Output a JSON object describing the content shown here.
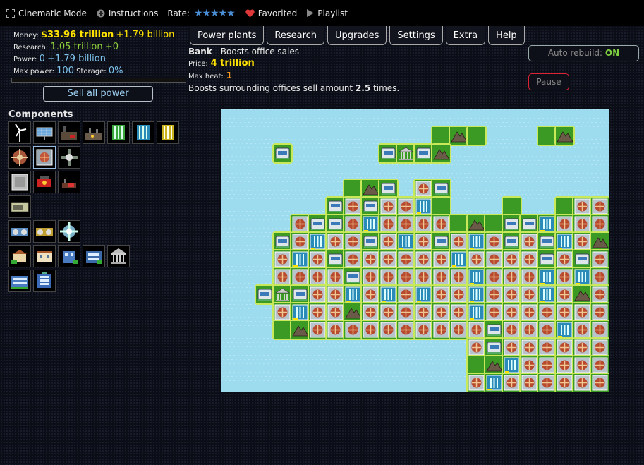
{
  "topbar": {
    "cinematic_label": "Cinematic Mode",
    "instructions_label": "Instructions",
    "rate_label": "Rate:",
    "stars": "★★★★★",
    "favorited_label": "Favorited",
    "playlist_label": "Playlist"
  },
  "stats": {
    "money_label": "Money:",
    "money_value": "$33.96 trillion",
    "money_rate": "+1.79 billion",
    "research_label": "Research:",
    "research_value": "1.05 trillion",
    "research_rate": "+0",
    "power_label": "Power:",
    "power_value": "0",
    "power_rate": "+1.79 billion",
    "maxpower_label": "Max power:",
    "maxpower_value": "100",
    "storage_label": "Storage:",
    "storage_value": "0%",
    "storage_fill": 0
  },
  "sell_button": "Sell all power",
  "tabs": [
    "Power plants",
    "Research",
    "Upgrades",
    "Settings",
    "Extra",
    "Help"
  ],
  "info": {
    "name": "Bank",
    "desc": " - Boosts office sales",
    "price_label": "Price:",
    "price_value": "4 trillion",
    "heat_label": "Max heat:",
    "heat_value": "1",
    "effect_pre": "Boosts surrounding offices sell amount ",
    "effect_value": "2.5",
    "effect_post": " times."
  },
  "auto_rebuild": {
    "label": "Auto rebuild:",
    "value": "ON"
  },
  "pause_button": "Pause",
  "components_title": "Components",
  "component_rows": [
    [
      "wind-turbine-icon",
      "solar-panel-icon",
      "coal-plant-icon",
      "gas-plant-icon",
      "nuclear-cell-icon",
      "fusion-cell-icon",
      "cell-icon"
    ],
    [
      "heat-exchanger-icon",
      "heat-vent-icon",
      "cooling-fan-icon"
    ],
    [
      "isolation-plate-icon",
      "heat-inlet-icon",
      "heat-outlet-icon"
    ],
    [
      "battery-icon"
    ],
    [
      "generator-icon",
      "reactor-core-icon",
      "research-center-icon"
    ],
    [
      "small-office-icon",
      "office-icon",
      "office-building-icon",
      "big-office-icon",
      "bank-icon"
    ],
    [
      "city-hall-icon",
      "headquarters-icon"
    ]
  ],
  "colors": {
    "money": "#ffe100",
    "research": "#8fcf3c",
    "power": "#7ec3ee",
    "water": "#9ddcef",
    "grass": "#3a9a24",
    "tile": "#b9c3cc"
  }
}
